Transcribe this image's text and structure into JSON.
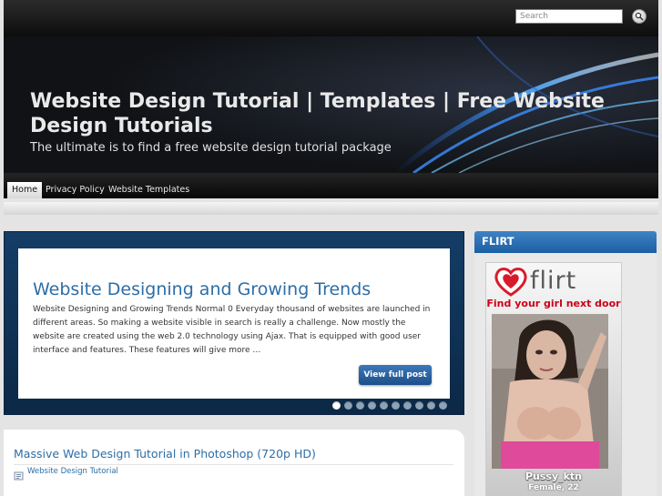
{
  "search": {
    "placeholder": "Search"
  },
  "header": {
    "title": "Website Design Tutorial | Templates | Free Website Design Tutorials",
    "tagline": "The ultimate is to find a free website design tutorial package"
  },
  "nav": {
    "items": [
      {
        "label": "Home",
        "active": true
      },
      {
        "label": "Privacy Policy",
        "active": false
      },
      {
        "label": "Website Templates",
        "active": false
      }
    ]
  },
  "featured": {
    "title": "Website Designing and Growing Trends",
    "excerpt": "Website Designing and Growing Trends Normal 0 Everyday thousand of websites are launched in different areas. So making a website visible in search is really a challenge. Now mostly the website are created using the web 2.0 technology using Ajax. That is equipped with good user interface and features. These features will give more …",
    "button_label": "View full post",
    "slide_count": 10,
    "active_slide": 1
  },
  "post": {
    "title": "Massive Web Design Tutorial in Photoshop (720p HD)",
    "category": "Website Design Tutorial"
  },
  "sidebar": {
    "title": "FLIRT",
    "ad": {
      "logo": "flirt",
      "tagline": "Find your girl next door",
      "name": "Pussy_ktn",
      "meta": "Female, 22"
    }
  },
  "colors": {
    "link_blue": "#2d6ea6",
    "featured_bg": "#143d66",
    "sidebar_header": "#2a6db3",
    "ad_red": "#cc0018"
  }
}
